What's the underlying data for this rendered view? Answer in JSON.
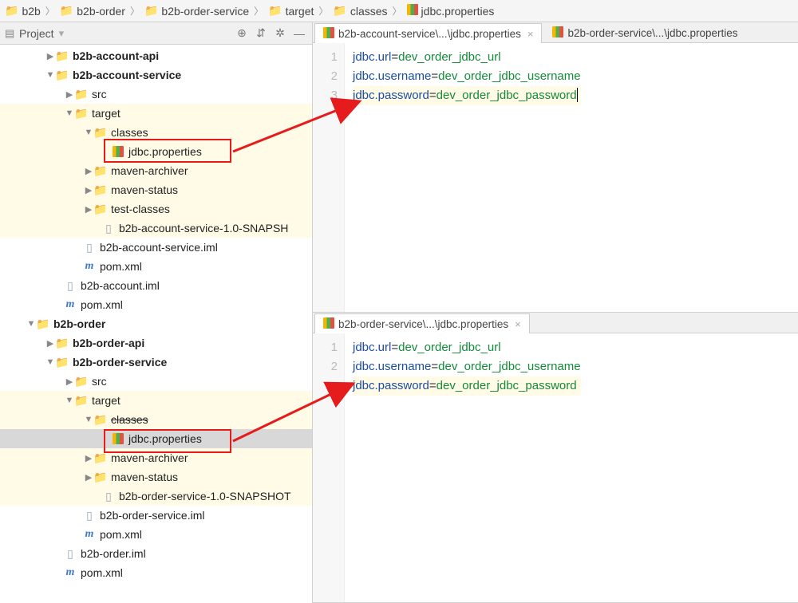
{
  "breadcrumbs": [
    "b2b",
    "b2b-order",
    "b2b-order-service",
    "target",
    "classes",
    "jdbc.properties"
  ],
  "project_panel": {
    "title": "Project"
  },
  "tree": {
    "b2b_account_api": "b2b-account-api",
    "b2b_account_service": "b2b-account-service",
    "src": "src",
    "target": "target",
    "classes": "classes",
    "jdbc_properties": "jdbc.properties",
    "maven_archiver": "maven-archiver",
    "maven_status": "maven-status",
    "test_classes": "test-classes",
    "snapshot_account": "b2b-account-service-1.0-SNAPSH",
    "account_iml": "b2b-account-service.iml",
    "pom": "pom.xml",
    "b2b_account_iml": "b2b-account.iml",
    "b2b_order": "b2b-order",
    "b2b_order_api": "b2b-order-api",
    "b2b_order_service": "b2b-order-service",
    "snapshot_order": "b2b-order-service-1.0-SNAPSHOT",
    "order_service_iml": "b2b-order-service.iml",
    "b2b_order_iml": "b2b-order.iml"
  },
  "editor1": {
    "tab1": "b2b-account-service\\...\\jdbc.properties",
    "tab2": "b2b-order-service\\...\\jdbc.properties",
    "lines": [
      {
        "key": "jdbc.url",
        "value": "dev_order_jdbc_url"
      },
      {
        "key": "jdbc.username",
        "value": "dev_order_jdbc_username"
      },
      {
        "key": "jdbc.password",
        "value": "dev_order_jdbc_password"
      }
    ]
  },
  "editor2": {
    "tab1": "b2b-order-service\\...\\jdbc.properties",
    "lines": [
      {
        "key": "jdbc.url",
        "value": "dev_order_jdbc_url"
      },
      {
        "key": "jdbc.username",
        "value": "dev_order_jdbc_username"
      },
      {
        "key": "jdbc.password",
        "value": "dev_order_jdbc_password"
      }
    ]
  }
}
